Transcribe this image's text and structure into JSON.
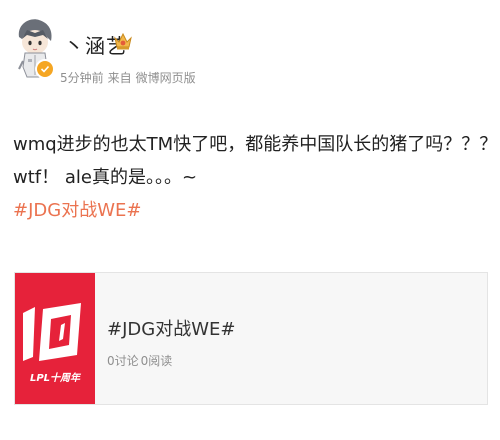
{
  "author": {
    "name": "丶涵艺",
    "avatar_icon": "cartoon-avatar-icon",
    "verified_icon": "verified-badge-icon",
    "badge_icon": "crown-badge-icon"
  },
  "meta": {
    "time": "5分钟前",
    "source_prefix": "来自",
    "source": "微博网页版"
  },
  "content": {
    "line1": "wmq进步的也太TM快了吧，都能养中国队长的猪了吗？？？",
    "line2": "wtf！ ale真的是。。。~",
    "hashtag": "#JDG对战WE#"
  },
  "topic_card": {
    "title": "#JDG对战WE#",
    "discuss_count": "0讨论",
    "read_count": "0阅读",
    "logo_text": "LPL十周年",
    "logo_number": "10"
  },
  "colors": {
    "hashtag": "#eb7350",
    "card_logo_bg": "#e6223a"
  }
}
